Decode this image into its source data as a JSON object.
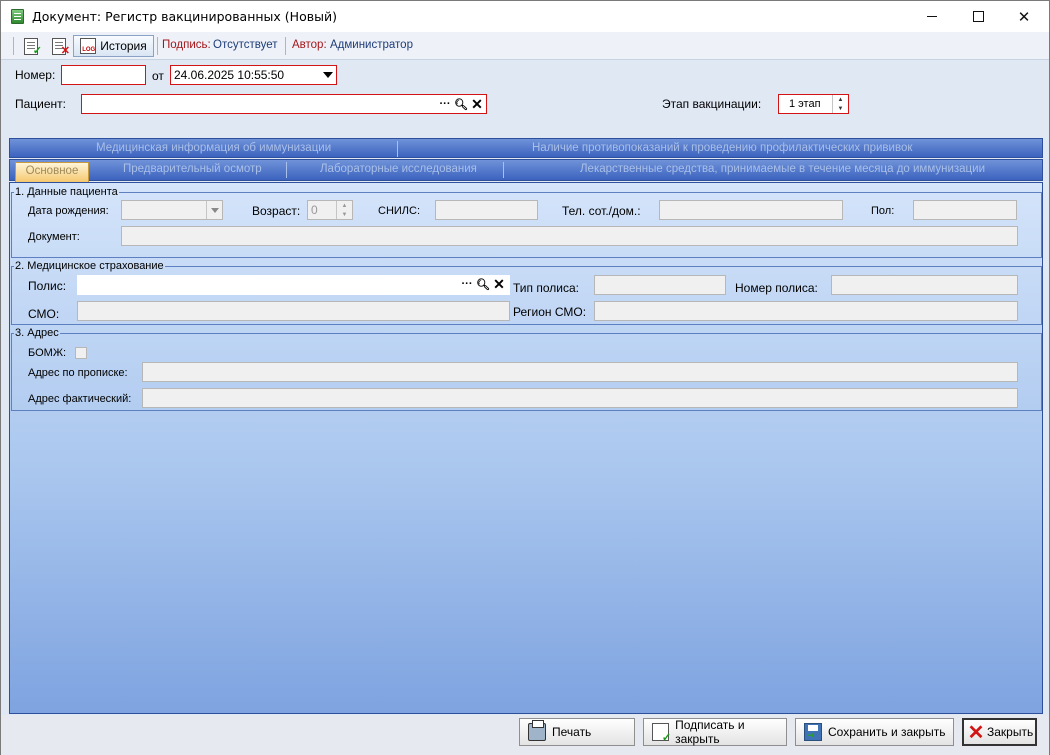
{
  "window": {
    "title": "Документ: Регистр вакцинированных (Новый)"
  },
  "toolbar": {
    "history_label": "История",
    "signature_label": "Подпись:",
    "signature_value": "Отсутствует",
    "author_label": "Автор:",
    "author_value": "Администратор"
  },
  "header": {
    "number_label": "Номер:",
    "number_value": "",
    "from_label": "от",
    "date_value": "24.06.2025 10:55:50",
    "patient_label": "Пациент:",
    "patient_value": "",
    "stage_label": "Этап вакцинации:",
    "stage_value": "1 этап"
  },
  "tabs": {
    "row1": [
      "Медицинская информация об иммунизации",
      "Наличие противопоказаний к проведению профилактических прививок"
    ],
    "row2": [
      "Основное",
      "Предварительный осмотр",
      "Лабораторные исследования",
      "Лекарственные средства, принимаемые в течение месяца до иммунизации"
    ],
    "active": "Основное"
  },
  "patient_data": {
    "legend": "1. Данные пациента",
    "birth_label": "Дата рождения:",
    "age_label": "Возраст:",
    "age_value": "0",
    "snils_label": "СНИЛС:",
    "phone_label": "Тел. сот./дом.:",
    "sex_label": "Пол:",
    "document_label": "Документ:"
  },
  "insurance": {
    "legend": "2. Медицинское страхование",
    "policy_label": "Полис:",
    "policy_type_label": "Тип полиса:",
    "policy_number_label": "Номер полиса:",
    "smo_label": "СМО:",
    "smo_region_label": "Регион СМО:"
  },
  "address": {
    "legend": "3. Адрес",
    "homeless_label": "БОМЖ:",
    "registered_label": "Адрес по прописке:",
    "actual_label": "Адрес фактический:"
  },
  "buttons": {
    "print": "Печать",
    "sign_close": "Подписать и закрыть",
    "save_close": "Сохранить и закрыть",
    "close": "Закрыть"
  },
  "icons": [
    "app-icon",
    "post-icon",
    "unpost-icon",
    "history-log-icon",
    "ellipsis-icon",
    "search-icon",
    "clear-icon",
    "dropdown-arrow-icon",
    "printer-icon",
    "sign-icon",
    "save-icon",
    "close-icon"
  ],
  "colors": {
    "required_border": "#d21414",
    "tab_blue": "#3c63bf",
    "active_tab": "#f5c870",
    "label_red": "#a3161a",
    "value_blue": "#1e3c78"
  }
}
